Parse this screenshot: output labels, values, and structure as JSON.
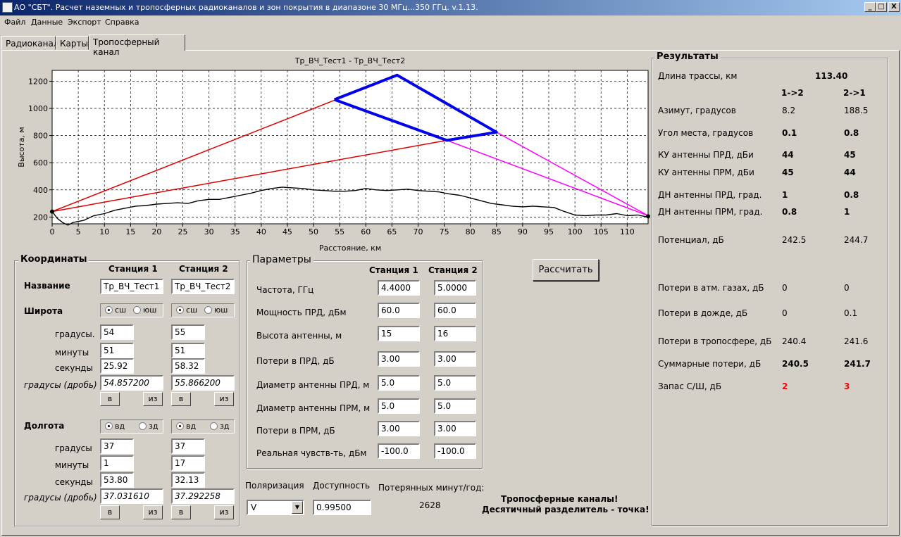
{
  "window": {
    "title": "АО \"СБТ\". Расчет наземных и тропосферных радиоканалов и зон покрытия в диапазоне 30 МГц...350 ГГц.  v.1.13.",
    "min_label": "_",
    "max_label": "□",
    "close_label": "X"
  },
  "menu": [
    "Файл",
    "Данные",
    "Экспорт",
    "Справка"
  ],
  "tabs": [
    "Радиоканал",
    "Карты",
    "Тропосферный канал"
  ],
  "active_tab": 2,
  "chart_data": {
    "type": "line",
    "title": "Тр_ВЧ_Тест1 - Тр_ВЧ_Тест2",
    "xlabel": "Расстояние, км",
    "ylabel": "Высота, м",
    "xlim": [
      0,
      114
    ],
    "ylim": [
      150,
      1280
    ],
    "x_ticks": [
      0,
      5,
      10,
      15,
      20,
      25,
      30,
      35,
      40,
      45,
      50,
      55,
      60,
      65,
      70,
      75,
      80,
      85,
      90,
      95,
      100,
      105,
      110
    ],
    "y_ticks": [
      200,
      400,
      600,
      800,
      1000,
      1200
    ],
    "grid": true,
    "series": [
      {
        "color": "#000000",
        "points": [
          [
            0,
            240
          ],
          [
            1,
            190
          ],
          [
            2,
            160
          ],
          [
            3,
            140
          ],
          [
            4,
            160
          ],
          [
            6,
            175
          ],
          [
            8,
            210
          ],
          [
            10,
            225
          ],
          [
            12,
            250
          ],
          [
            14,
            265
          ],
          [
            16,
            280
          ],
          [
            18,
            285
          ],
          [
            20,
            295
          ],
          [
            22,
            300
          ],
          [
            24,
            305
          ],
          [
            26,
            300
          ],
          [
            28,
            320
          ],
          [
            30,
            330
          ],
          [
            32,
            330
          ],
          [
            34,
            345
          ],
          [
            36,
            360
          ],
          [
            38,
            375
          ],
          [
            40,
            395
          ],
          [
            42,
            410
          ],
          [
            44,
            420
          ],
          [
            46,
            415
          ],
          [
            48,
            410
          ],
          [
            50,
            400
          ],
          [
            52,
            395
          ],
          [
            54,
            390
          ],
          [
            56,
            390
          ],
          [
            58,
            395
          ],
          [
            60,
            410
          ],
          [
            62,
            400
          ],
          [
            64,
            395
          ],
          [
            66,
            400
          ],
          [
            68,
            405
          ],
          [
            70,
            395
          ],
          [
            72,
            390
          ],
          [
            74,
            385
          ],
          [
            76,
            370
          ],
          [
            78,
            360
          ],
          [
            80,
            340
          ],
          [
            82,
            320
          ],
          [
            84,
            300
          ],
          [
            86,
            290
          ],
          [
            88,
            280
          ],
          [
            90,
            275
          ],
          [
            92,
            280
          ],
          [
            94,
            275
          ],
          [
            96,
            270
          ],
          [
            98,
            240
          ],
          [
            100,
            215
          ],
          [
            102,
            210
          ],
          [
            104,
            215
          ],
          [
            106,
            215
          ],
          [
            108,
            225
          ],
          [
            110,
            210
          ],
          [
            112,
            215
          ],
          [
            114,
            200
          ]
        ]
      },
      {
        "color": "#dd0000",
        "points": [
          [
            0,
            240
          ],
          [
            54,
            1060
          ]
        ]
      },
      {
        "color": "#dd0000",
        "points": [
          [
            0,
            240
          ],
          [
            75.5,
            765
          ]
        ]
      },
      {
        "color": "#ff00ff",
        "points": [
          [
            85,
            825
          ],
          [
            114,
            210
          ]
        ]
      },
      {
        "color": "#ff00ff",
        "points": [
          [
            75.5,
            765
          ],
          [
            114,
            210
          ]
        ]
      },
      {
        "color": "#0000ee",
        "points": [
          [
            54,
            1065
          ],
          [
            66,
            1245
          ],
          [
            85,
            825
          ],
          [
            75.5,
            765
          ],
          [
            54,
            1065
          ]
        ]
      }
    ]
  },
  "coords": {
    "title": "Координаты",
    "station1_header": "Станция 1",
    "station2_header": "Станция 2",
    "name_label": "Название",
    "lat_label": "Широта",
    "lon_label": "Долгота",
    "deg_label": "градусы.",
    "min_label": "минуты",
    "sec_label": "секунды",
    "frac_label": "градусы (дробь)",
    "deg_label2": "градусы",
    "ns_n": "сш",
    "ns_s": "юш",
    "ew_e": "вд",
    "ew_w": "зд",
    "to_btn": "в",
    "from_btn": "из",
    "s1": {
      "name": "Тр_ВЧ_Тест1",
      "lat_deg": "54",
      "lat_min": "51",
      "lat_sec": "25.92",
      "lat_frac": "54.857200",
      "lon_deg": "37",
      "lon_min": "1",
      "lon_sec": "53.80",
      "lon_frac": "37.031610"
    },
    "s2": {
      "name": "Тр_ВЧ_Тест2",
      "lat_deg": "55",
      "lat_min": "51",
      "lat_sec": "58.32",
      "lat_frac": "55.866200",
      "lon_deg": "37",
      "lon_min": "17",
      "lon_sec": "32.13",
      "lon_frac": "37.292258"
    }
  },
  "params": {
    "title": "Параметры",
    "station1_header": "Станция 1",
    "station2_header": "Станция 2",
    "rows": [
      {
        "label": "Частота, ГГц",
        "v1": "4.4000",
        "v2": "5.0000"
      },
      {
        "label": "Мощность ПРД, дБм",
        "v1": "60.0",
        "v2": "60.0"
      },
      {
        "label": "Высота антенны, м",
        "v1": "15",
        "v2": "16"
      },
      {
        "label": "Потери в ПРД, дБ",
        "v1": "3.00",
        "v2": "3.00"
      },
      {
        "label": "Диаметр антенны ПРД, м",
        "v1": "5.0",
        "v2": "5.0"
      },
      {
        "label": "Диаметр антенны ПРМ, м",
        "v1": "5.0",
        "v2": "5.0"
      },
      {
        "label": "Потери в  ПРМ, дБ",
        "v1": "3.00",
        "v2": "3.00"
      },
      {
        "label": "Реальная чувств-ть, дБм",
        "v1": "-100.0",
        "v2": "-100.0"
      }
    ]
  },
  "calc_button": "Рассчитать",
  "bottom": {
    "polarization_label": "Поляризация",
    "polarization_value": "V",
    "availability_label": "Доступность",
    "availability_value": "0.99500",
    "lost_label": "Потерянных минут/год:",
    "lost_value": "2628",
    "note_line1": "Тропосферные каналы!",
    "note_line2": "Десятичный разделитель - точка!"
  },
  "results": {
    "title": "Результаты",
    "length_label": "Длина трассы, км",
    "length_value": "113.40",
    "dir12": "1->2",
    "dir21": "2->1",
    "rows": [
      {
        "label": "Азимут, градусов",
        "v1": "8.2",
        "v2": "188.5",
        "bold": false
      },
      {
        "label": "Угол места, градусов",
        "v1": "0.1",
        "v2": "0.8",
        "bold": true
      },
      {
        "label": "КУ антенны ПРД, дБи",
        "v1": "44",
        "v2": "45",
        "bold": true
      },
      {
        "label": "КУ антенны ПРМ, дБи",
        "v1": "45",
        "v2": "44",
        "bold": true
      },
      {
        "label": "ДН антенны ПРД, град.",
        "v1": "1",
        "v2": "0.8",
        "bold": true
      },
      {
        "label": "ДН антенны ПРМ, град.",
        "v1": "0.8",
        "v2": "1",
        "bold": true
      },
      {
        "label": "Потенциал, дБ",
        "v1": "242.5",
        "v2": "244.7",
        "bold": false
      },
      {
        "label": "Потери в атм. газах, дБ",
        "v1": "0",
        "v2": "0",
        "bold": false
      },
      {
        "label": "Потери в дожде, дБ",
        "v1": "0",
        "v2": "0.1",
        "bold": false
      },
      {
        "label": "Потери в тропосфере, дБ",
        "v1": "240.4",
        "v2": "241.6",
        "bold": false
      },
      {
        "label": "Суммарные потери, дБ",
        "v1": "240.5",
        "v2": "241.7",
        "bold": true
      },
      {
        "label": "Запас С/Ш, дБ",
        "v1": "2",
        "v2": "3",
        "bold": true,
        "color": "#ff0000"
      }
    ]
  }
}
